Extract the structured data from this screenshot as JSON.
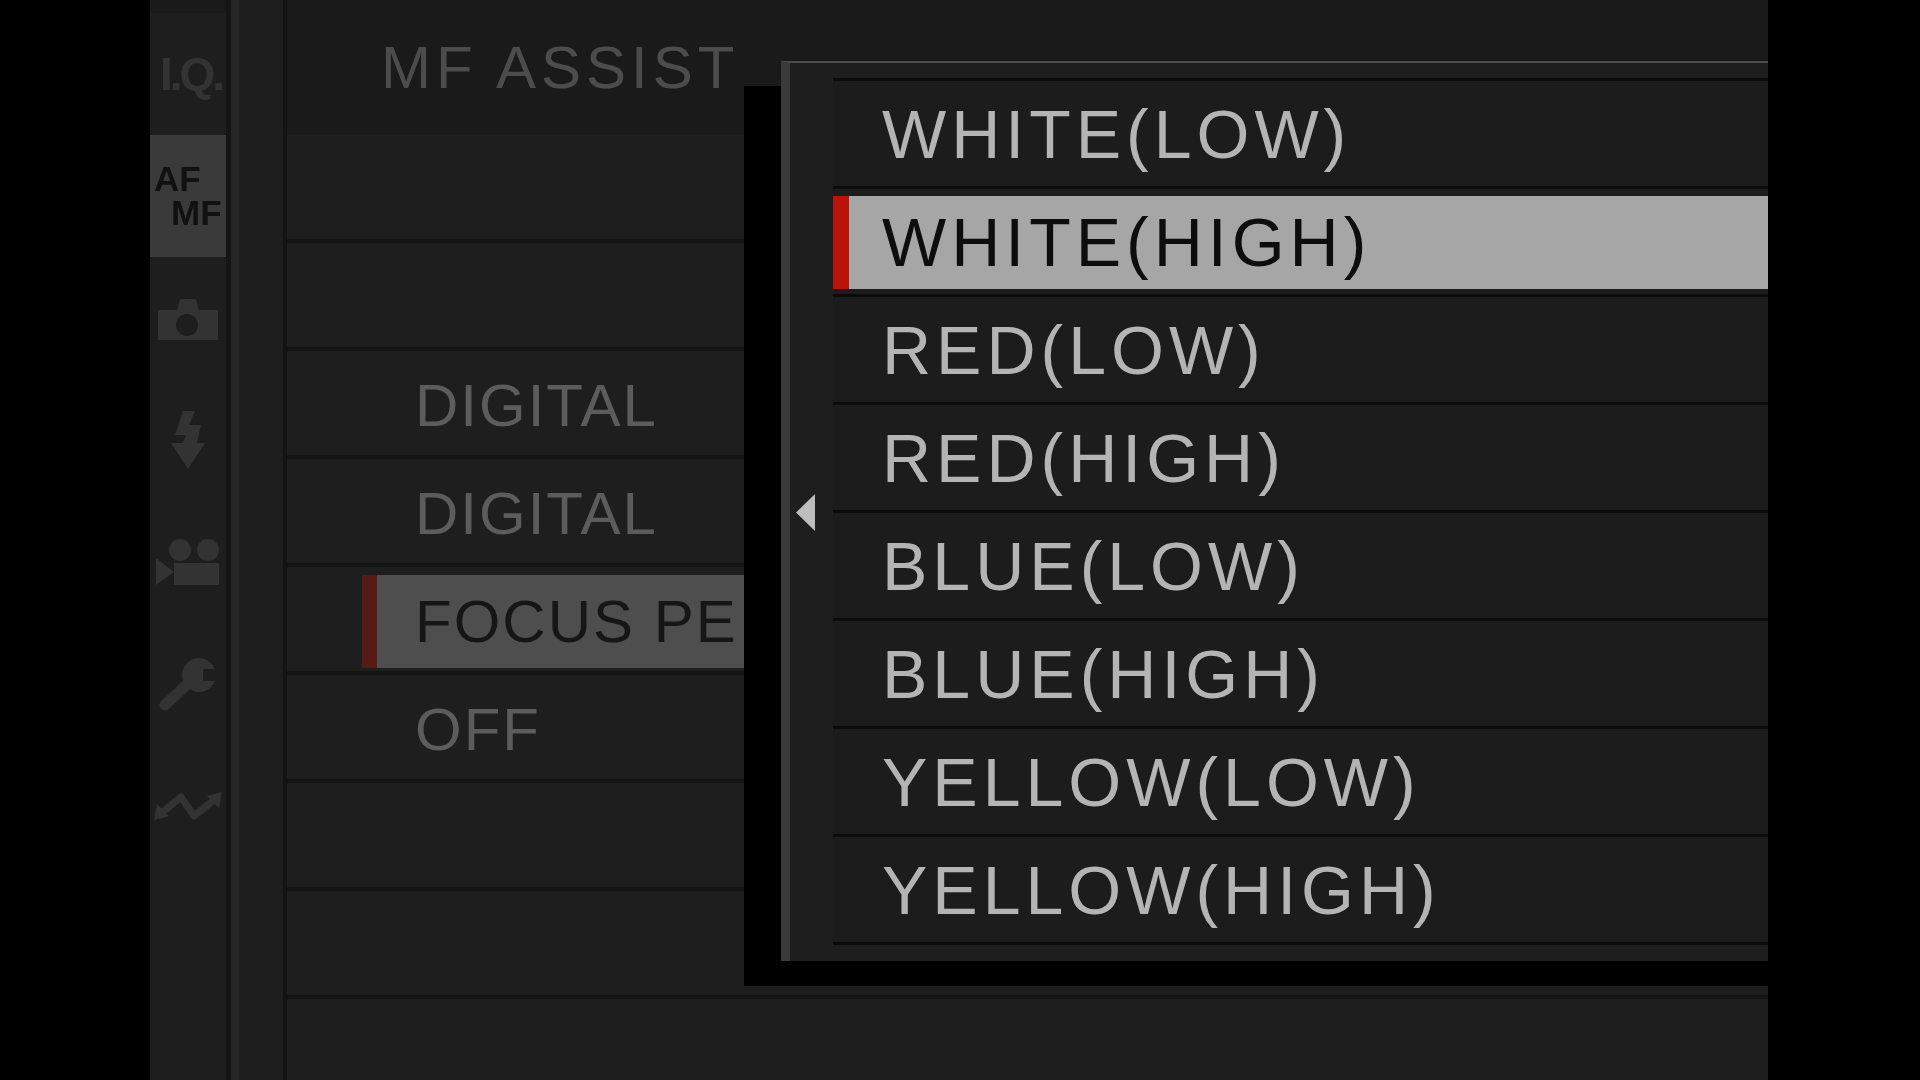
{
  "sidebar": {
    "tabs": [
      {
        "kind": "text",
        "lines": [
          "I.Q."
        ],
        "selected": false
      },
      {
        "kind": "text",
        "lines": [
          "AF",
          "MF"
        ],
        "selected": true
      },
      {
        "kind": "icon",
        "selected": false
      },
      {
        "kind": "icon",
        "selected": false
      },
      {
        "kind": "icon",
        "selected": false
      },
      {
        "kind": "icon",
        "selected": false
      },
      {
        "kind": "icon",
        "selected": false
      }
    ]
  },
  "menu": {
    "title": "MF ASSIST",
    "rows": [
      {
        "selected": false
      },
      {
        "selected": false
      },
      {
        "label": "DIGITAL",
        "selected": false
      },
      {
        "label": "DIGITAL",
        "selected": false
      },
      {
        "label": "FOCUS PE",
        "selected": true
      },
      {
        "label": "OFF",
        "selected": false
      },
      {
        "selected": false
      },
      {
        "selected": false
      }
    ]
  },
  "popup": {
    "options": [
      {
        "label": "WHITE(LOW)",
        "selected": false
      },
      {
        "label": "WHITE(HIGH)",
        "selected": true
      },
      {
        "label": "RED(LOW)",
        "selected": false
      },
      {
        "label": "RED(HIGH)",
        "selected": false
      },
      {
        "label": "BLUE(LOW)",
        "selected": false
      },
      {
        "label": "BLUE(HIGH)",
        "selected": false
      },
      {
        "label": "YELLOW(LOW)",
        "selected": false
      },
      {
        "label": "YELLOW(HIGH)",
        "selected": false
      }
    ]
  }
}
